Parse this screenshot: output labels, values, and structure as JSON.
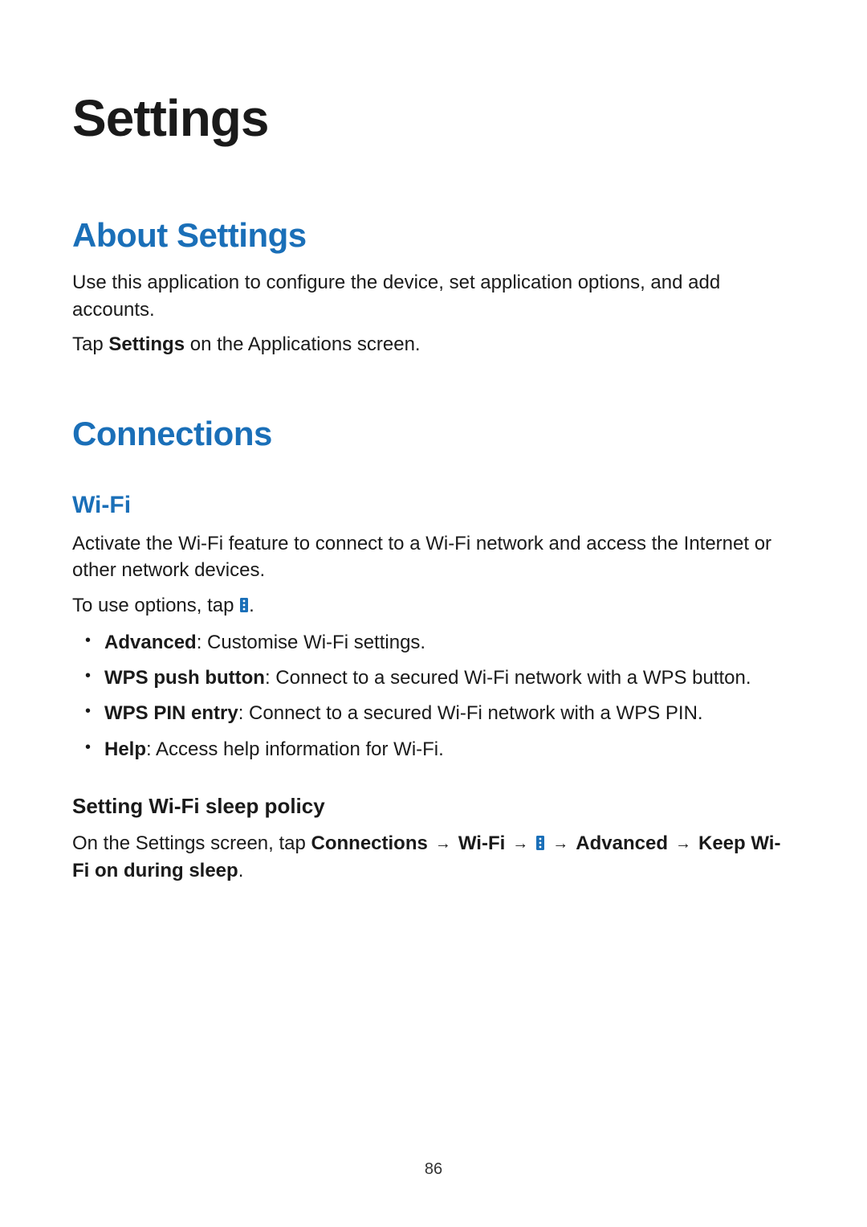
{
  "page": {
    "title": "Settings",
    "number": "86"
  },
  "about": {
    "heading": "About Settings",
    "intro": "Use this application to configure the device, set application options, and add accounts.",
    "tap_prefix": "Tap ",
    "tap_bold": "Settings",
    "tap_suffix": " on the Applications screen."
  },
  "connections": {
    "heading": "Connections",
    "wifi": {
      "heading": "Wi-Fi",
      "intro": "Activate the Wi-Fi feature to connect to a Wi-Fi network and access the Internet or other network devices.",
      "options_prefix": "To use options, tap ",
      "options_suffix": ".",
      "bullets": [
        {
          "bold": "Advanced",
          "rest": ": Customise Wi-Fi settings."
        },
        {
          "bold": "WPS push button",
          "rest": ": Connect to a secured Wi-Fi network with a WPS button."
        },
        {
          "bold": "WPS PIN entry",
          "rest": ": Connect to a secured Wi-Fi network with a WPS PIN."
        },
        {
          "bold": "Help",
          "rest": ": Access help information for Wi-Fi."
        }
      ],
      "sleep": {
        "heading": "Setting Wi-Fi sleep policy",
        "prefix": "On the Settings screen, tap ",
        "path1": "Connections",
        "path2": "Wi-Fi",
        "path3": "Advanced",
        "path4_a": "Keep Wi-Fi on",
        "path4_b": "during sleep",
        "suffix": "."
      }
    }
  },
  "icons": {
    "arrow": "→"
  }
}
